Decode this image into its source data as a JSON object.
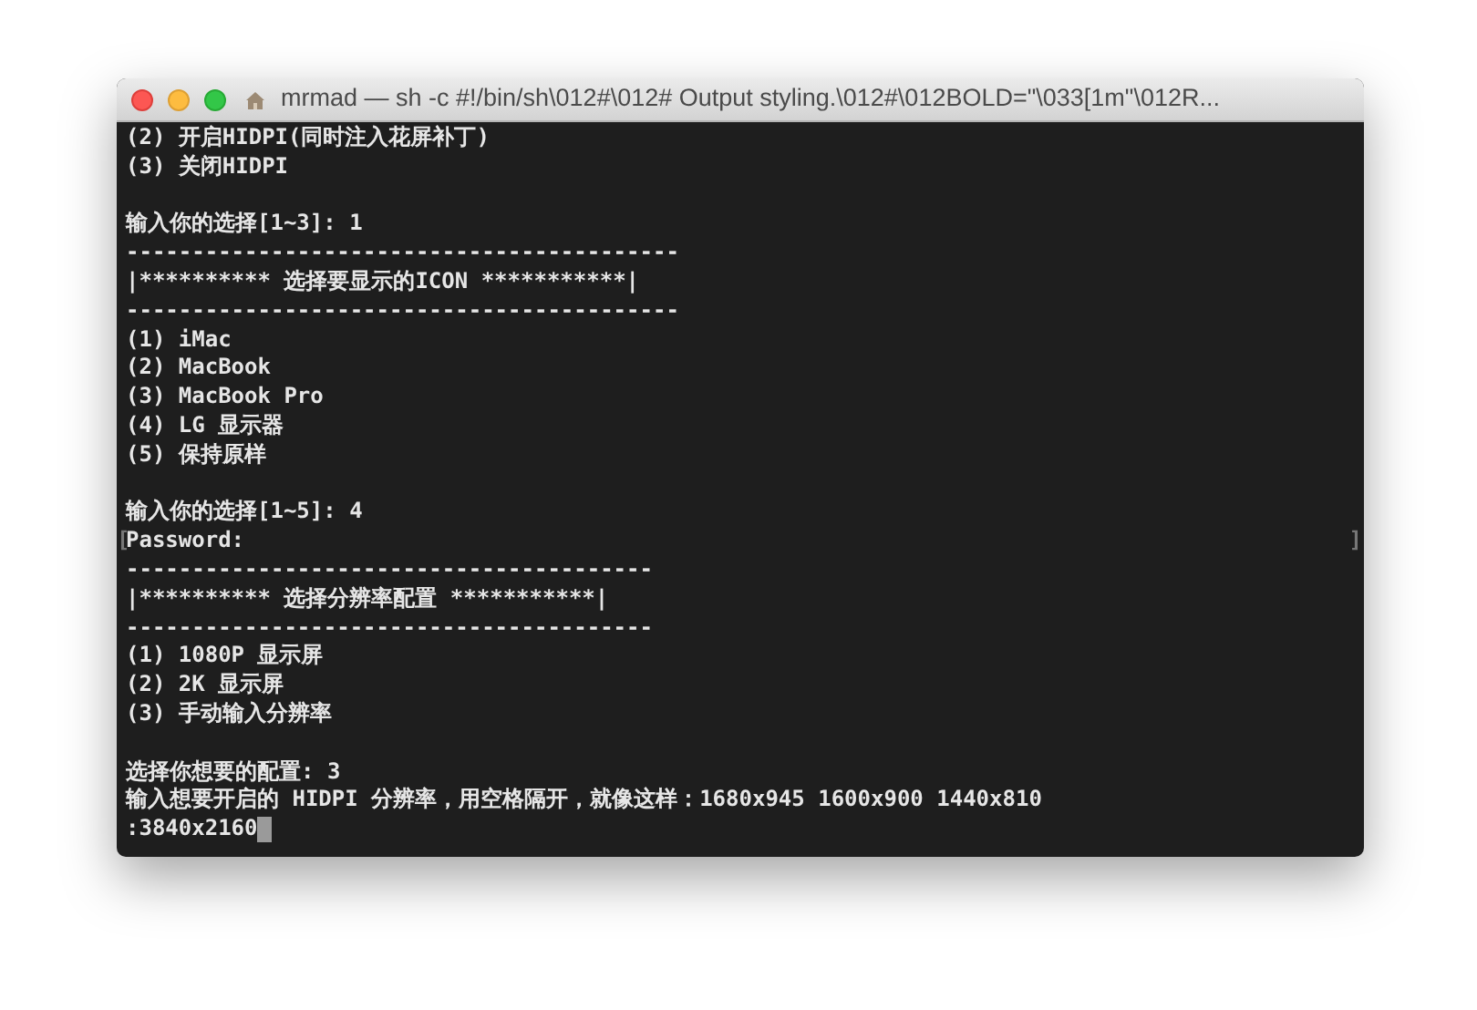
{
  "window": {
    "title": "mrmad — sh -c #!/bin/sh\\012#\\012# Output styling.\\012#\\012BOLD=\"\\033[1m\"\\012R..."
  },
  "terminal": {
    "lines": [
      {
        "kind": "text",
        "text": "(2) 开启HIDPI(同时注入花屏补丁)"
      },
      {
        "kind": "text",
        "text": "(3) 关闭HIDPI"
      },
      {
        "kind": "blank"
      },
      {
        "kind": "text",
        "text": "输入你的选择[1~3]: 1"
      },
      {
        "kind": "text",
        "text": "------------------------------------------"
      },
      {
        "kind": "text",
        "text": "|********** 选择要显示的ICON ***********|"
      },
      {
        "kind": "text",
        "text": "------------------------------------------"
      },
      {
        "kind": "text",
        "text": "(1) iMac"
      },
      {
        "kind": "text",
        "text": "(2) MacBook"
      },
      {
        "kind": "text",
        "text": "(3) MacBook Pro"
      },
      {
        "kind": "text",
        "text": "(4) LG 显示器"
      },
      {
        "kind": "text",
        "text": "(5) 保持原样"
      },
      {
        "kind": "blank"
      },
      {
        "kind": "text",
        "text": "输入你的选择[1~5]: 4"
      },
      {
        "kind": "marked",
        "text": "Password:",
        "left_mark": "[",
        "right_mark": "]"
      },
      {
        "kind": "text",
        "text": "----------------------------------------"
      },
      {
        "kind": "text",
        "text": "|********** 选择分辨率配置 ***********|"
      },
      {
        "kind": "text",
        "text": "----------------------------------------"
      },
      {
        "kind": "text",
        "text": "(1) 1080P 显示屏"
      },
      {
        "kind": "text",
        "text": "(2) 2K 显示屏"
      },
      {
        "kind": "text",
        "text": "(3) 手动输入分辨率"
      },
      {
        "kind": "blank"
      },
      {
        "kind": "text",
        "text": "选择你想要的配置: 3"
      },
      {
        "kind": "text",
        "text": "输入想要开启的 HIDPI 分辨率，用空格隔开，就像这样：1680x945 1600x900 1440x810"
      },
      {
        "kind": "prompt",
        "text": ":3840x2160",
        "cursor": true
      }
    ]
  }
}
